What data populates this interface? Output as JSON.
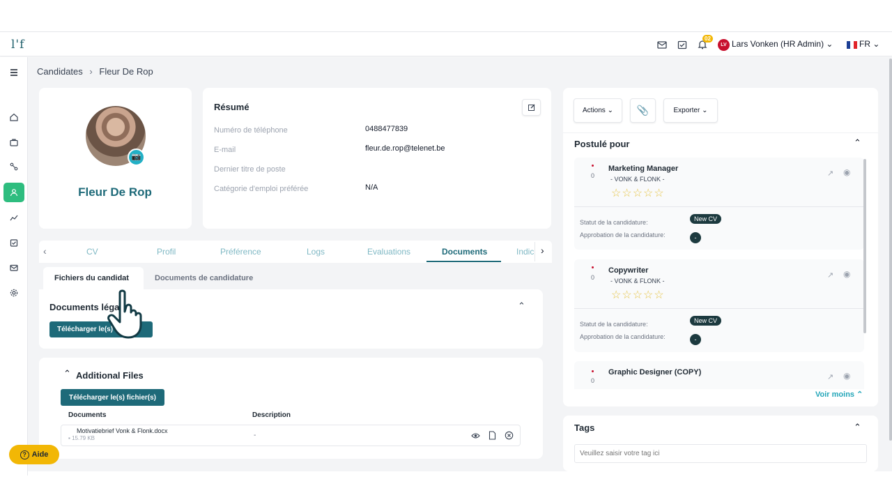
{
  "header": {
    "logo": "l'f",
    "notif_count": "02",
    "user_initials": "LV",
    "user_name": "Lars Vonken (HR Admin)",
    "lang": "FR"
  },
  "breadcrumb": {
    "root": "Candidates",
    "current": "Fleur De Rop"
  },
  "candidate": {
    "name": "Fleur De Rop"
  },
  "resume": {
    "title": "Résumé",
    "fields": [
      {
        "label": "Numéro de téléphone",
        "value": "0488477839"
      },
      {
        "label": "E-mail",
        "value": "fleur.de.rop@telenet.be"
      },
      {
        "label": "Dernier titre de poste",
        "value": ""
      },
      {
        "label": "Catégorie d'emploi préférée",
        "value": "N/A"
      }
    ]
  },
  "tabs": [
    "CV",
    "Profil",
    "Préférence",
    "Logs",
    "Evaluations",
    "Documents",
    "Indic"
  ],
  "subtabs": [
    "Fichiers du candidat",
    "Documents de candidature"
  ],
  "legal_docs": {
    "title": "Documents léga",
    "upload_label": "Télécharger le(s)"
  },
  "additional_files": {
    "title": "Additional Files",
    "upload_label": "Télécharger le(s) fichier(s)",
    "col_documents": "Documents",
    "col_description": "Description",
    "rows": [
      {
        "name": "Motivatiebrief Vonk & Flonk.docx",
        "size": "15.79 KB",
        "description": "-"
      }
    ]
  },
  "actions": {
    "actions_label": "Actions",
    "export_label": "Exporter"
  },
  "applied_for": {
    "title": "Postulé pour",
    "jobs": [
      {
        "title": "Marketing Manager",
        "company": "- VONK & FLONK -",
        "count": "0",
        "rating": 0,
        "status_label": "Statut de la candidature:",
        "status": "New CV",
        "approval_label": "Approbation de la candidature:",
        "approval": "-"
      },
      {
        "title": "Copywriter",
        "company": "- VONK & FLONK -",
        "count": "0",
        "rating": 0,
        "status_label": "Statut de la candidature:",
        "status": "New CV",
        "approval_label": "Approbation de la candidature:",
        "approval": "-"
      },
      {
        "title": "Graphic Designer (COPY)",
        "count": "0"
      }
    ],
    "see_less": "Voir moins"
  },
  "tags": {
    "title": "Tags",
    "placeholder": "Veuillez saisir votre tag ici"
  },
  "help": {
    "label": "Aide"
  },
  "colors": {
    "teal": "#1e6a79",
    "active_green": "#2ebd7f",
    "badge_yellow": "#f2b705"
  }
}
